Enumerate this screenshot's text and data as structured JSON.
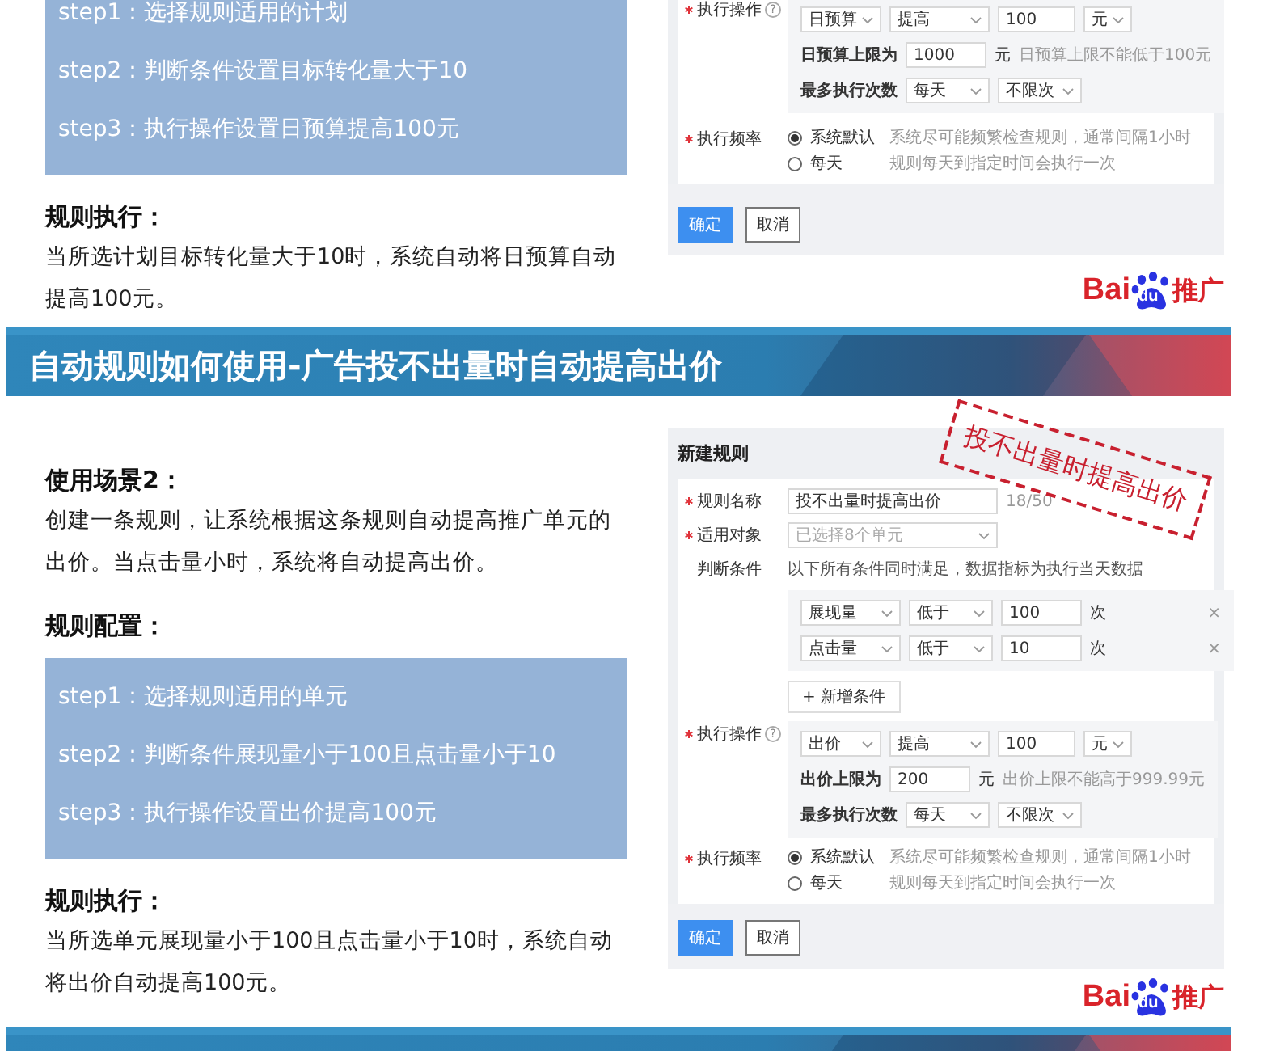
{
  "sections": [
    {
      "kind": "example",
      "steps": [
        "step1：选择规则适用的计划",
        "step2：判断条件设置目标转化量大于10",
        "step3：执行操作设置日预算提高100元"
      ],
      "result_heading": "规则执行：",
      "result_text": "当所选计划目标转化量大于10时，系统自动将日预算自动提高100元。",
      "form": {
        "rows": [
          {
            "kind": "action",
            "label": "执行操作",
            "required": true,
            "help": "?",
            "field": "日预算",
            "op": "提高",
            "amount": "100",
            "unit": "元",
            "limit_label": "日预算上限为",
            "limit_value": "1000",
            "limit_unit": "元",
            "limit_hint": "日预算上限不能低于100元",
            "times_label": "最多执行次数",
            "times_period": "每天",
            "times_limit": "不限次"
          },
          {
            "kind": "radio",
            "label": "执行频率",
            "required": true,
            "options": [
              {
                "label": "系统默认",
                "desc": "系统尽可能频繁检查规则，通常间隔1小时",
                "selected": true
              },
              {
                "label": "每天",
                "desc": "规则每天到指定时间会执行一次",
                "selected": false
              }
            ]
          }
        ],
        "buttons": [
          {
            "label": "确定",
            "primary": true
          },
          {
            "label": "取消",
            "primary": false
          }
        ]
      },
      "logo": {
        "left": "Bai",
        "paw": "du",
        "right": "推广"
      }
    },
    {
      "kind": "banner",
      "title": "自动规则如何使用-广告投不出量时自动提高出价"
    },
    {
      "kind": "example",
      "scenario_heading": "使用场景2：",
      "scenario_text": "创建一条规则，让系统根据这条规则自动提高推广单元的出价。当点击量小时，系统将自动提高出价。",
      "config_heading": "规则配置：",
      "steps": [
        "step1：选择规则适用的单元",
        "step2：判断条件展现量小于100且点击量小于10",
        "step3：执行操作设置出价提高100元"
      ],
      "result_heading": "规则执行：",
      "result_text": "当所选单元展现量小于100且点击量小于10时，系统自动将出价自动提高100元。",
      "form": {
        "title": "新建规则",
        "stamp": "投不出量时提高出价",
        "rows": [
          {
            "kind": "text",
            "label": "规则名称",
            "required": true,
            "value": "投不出量时提高出价",
            "counter": "18/50"
          },
          {
            "kind": "select",
            "label": "适用对象",
            "required": true,
            "placeholder": "已选择8个单元"
          },
          {
            "kind": "conditions",
            "label": "判断条件",
            "required": false,
            "note": "以下所有条件同时满足，数据指标为执行当天数据",
            "items": [
              {
                "field": "展现量",
                "op": "低于",
                "value": "100",
                "unit": "次",
                "remove": "×"
              },
              {
                "field": "点击量",
                "op": "低于",
                "value": "10",
                "unit": "次",
                "remove": "×"
              }
            ],
            "add_label": "+ 新增条件"
          },
          {
            "kind": "action",
            "label": "执行操作",
            "required": true,
            "help": "?",
            "field": "出价",
            "op": "提高",
            "amount": "100",
            "unit": "元",
            "limit_label": "出价上限为",
            "limit_value": "200",
            "limit_unit": "元",
            "limit_hint": "出价上限不能高于999.99元",
            "times_label": "最多执行次数",
            "times_period": "每天",
            "times_limit": "不限次"
          },
          {
            "kind": "radio",
            "label": "执行频率",
            "required": true,
            "options": [
              {
                "label": "系统默认",
                "desc": "系统尽可能频繁检查规则，通常间隔1小时",
                "selected": true
              },
              {
                "label": "每天",
                "desc": "规则每天到指定时间会执行一次",
                "selected": false
              }
            ]
          }
        ],
        "buttons": [
          {
            "label": "确定",
            "primary": true
          },
          {
            "label": "取消",
            "primary": false
          }
        ]
      },
      "logo": {
        "left": "Bai",
        "paw": "du",
        "right": "推广"
      }
    },
    {
      "kind": "banner"
    }
  ]
}
